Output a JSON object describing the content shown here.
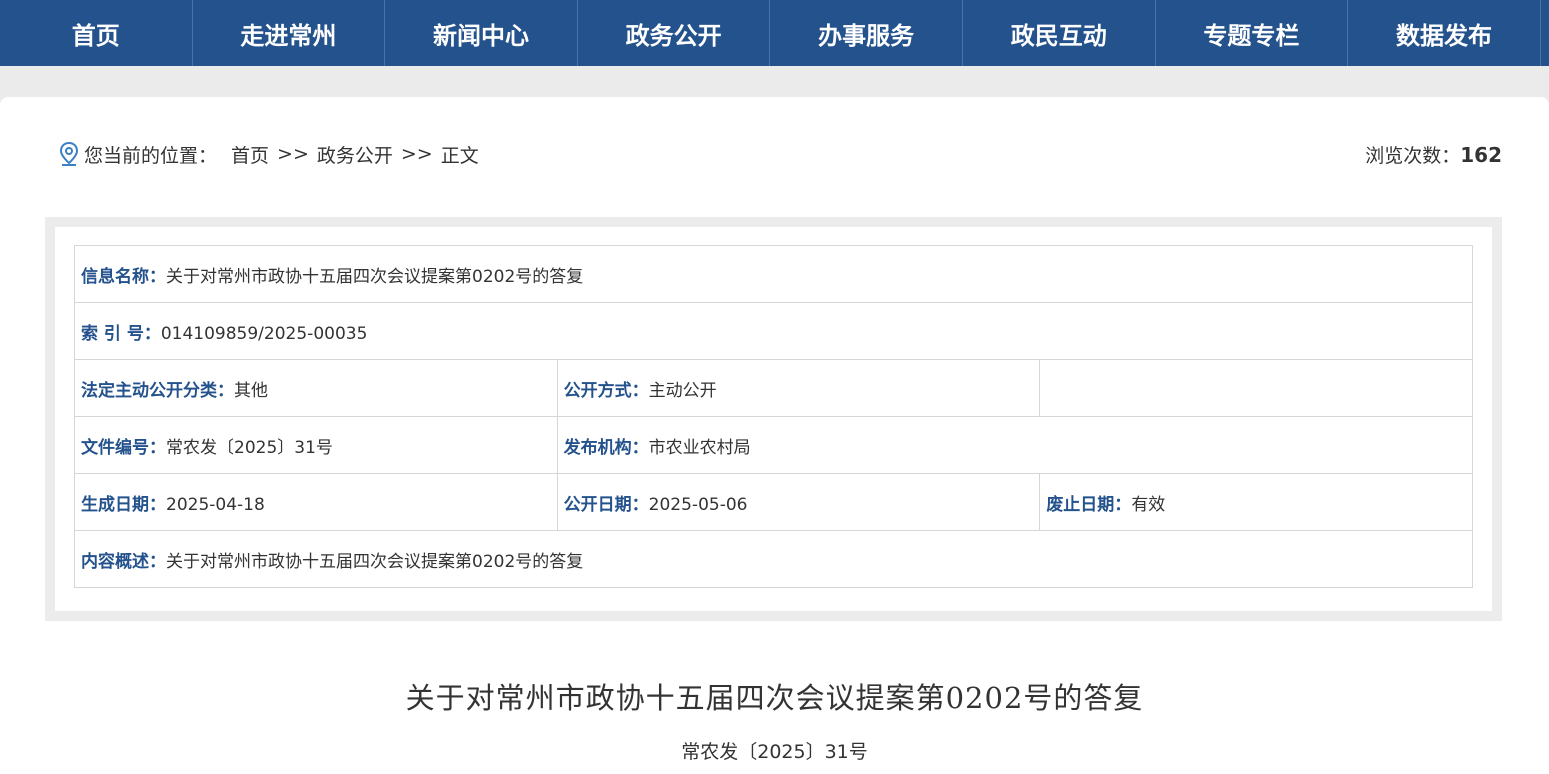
{
  "nav": [
    "首页",
    "走进常州",
    "新闻中心",
    "政务公开",
    "办事服务",
    "政民互动",
    "专题专栏",
    "数据发布"
  ],
  "breadcrumb": {
    "label": "您当前的位置：",
    "items": [
      "首页",
      "政务公开",
      "正文"
    ],
    "sep": ">>"
  },
  "views": {
    "label": "浏览次数：",
    "count": "162"
  },
  "meta": {
    "info_name_k": "信息名称：",
    "info_name_v": "关于对常州市政协十五届四次会议提案第0202号的答复",
    "index_k": "索 引 号：",
    "index_v": "014109859/2025-00035",
    "category_k": "法定主动公开分类：",
    "category_v": "其他",
    "method_k": "公开方式：",
    "method_v": "主动公开",
    "docno_k": "文件编号：",
    "docno_v": "常农发〔2025〕31号",
    "org_k": "发布机构：",
    "org_v": "市农业农村局",
    "created_k": "生成日期：",
    "created_v": "2025-04-18",
    "public_k": "公开日期：",
    "public_v": "2025-05-06",
    "expire_k": "废止日期：",
    "expire_v": "有效",
    "summary_k": "内容概述：",
    "summary_v": "关于对常州市政协十五届四次会议提案第0202号的答复"
  },
  "doc": {
    "title": "关于对常州市政协十五届四次会议提案第0202号的答复",
    "number": "常农发〔2025〕31号"
  }
}
